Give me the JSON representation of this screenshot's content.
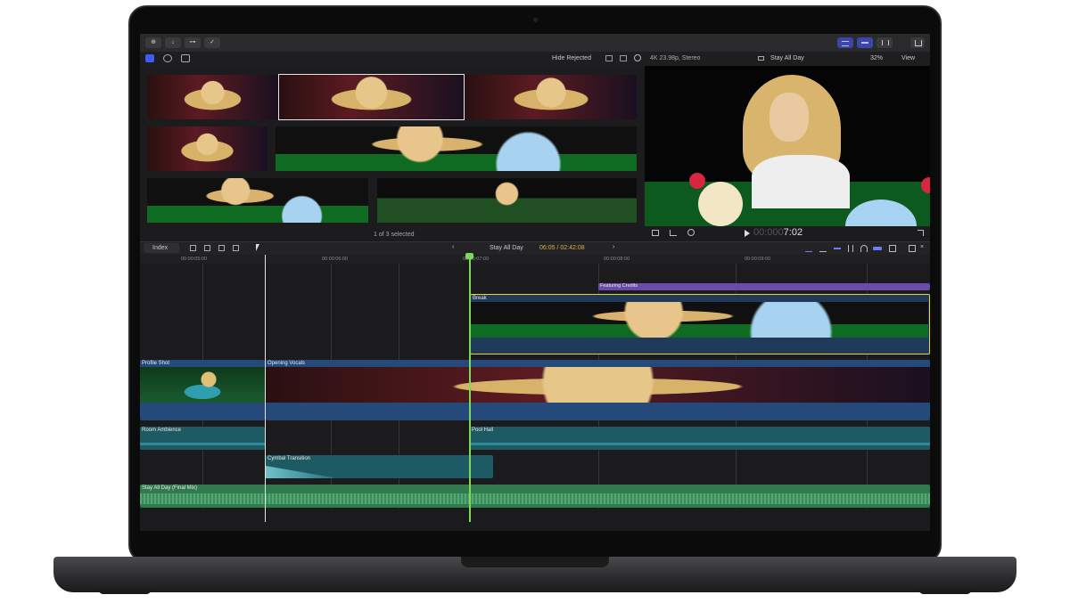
{
  "toolbar": {
    "library_btn": "⊕",
    "import_btn": "↓",
    "keys_btn": "⊶",
    "check_btn": "✓"
  },
  "browser": {
    "filter_label": "Hide Rejected",
    "selection_status": "1 of 3 selected"
  },
  "viewer": {
    "format": "4K 23.98p, Stereo",
    "project_name": "Stay All Day",
    "zoom": "32%",
    "view_menu": "View",
    "timecode": "00:00:07:02",
    "timecode_dim": "00:000",
    "timecode_bright": "7:02"
  },
  "timeline_bar": {
    "index_label": "Index",
    "project_name": "Stay All Day",
    "timecode": "06:05 / 02:42:08"
  },
  "ruler": {
    "ticks": [
      "00:00:05:00",
      "00:00:06:00",
      "00:00:07:00",
      "00:00:08:00",
      "00:00:09:00"
    ]
  },
  "clips": {
    "title_clip": "Featuring Credits",
    "connected_clip": "Break",
    "primary_a": "Profile Shot",
    "primary_b": "Opening Vocals",
    "audio_a": "Room Ambience",
    "audio_b": "Pool Hall",
    "audio_c": "Cymbal Transition",
    "music": "Stay All Day (Final Mix)"
  },
  "colors": {
    "accent_blue": "#5a6cff",
    "playhead": "#7ed957",
    "title_purple": "#6a4ba8",
    "selection_yellow": "#e8d43a",
    "video_blue": "#254a7a",
    "audio_teal": "#1d5a63",
    "music_green": "#2f7a4f"
  }
}
